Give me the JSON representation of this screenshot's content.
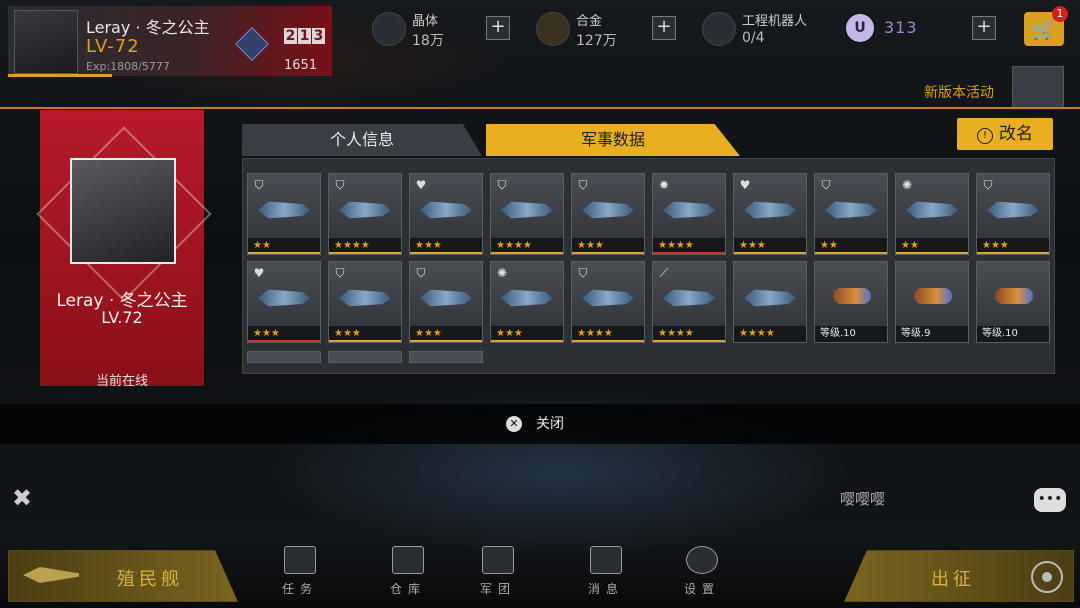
{
  "player": {
    "name": "Leray · 冬之公主",
    "level": "LV-72",
    "exp": "Exp:1808/5777",
    "rank_digits": [
      "2",
      "1",
      "3"
    ],
    "rank_score": "1651"
  },
  "resources": {
    "crystal": {
      "label": "晶体",
      "value": "18万"
    },
    "alloy": {
      "label": "合金",
      "value": "127万"
    },
    "robots": {
      "label": "工程机器人",
      "value": "0/4"
    },
    "u_currency": {
      "symbol": "U",
      "value": "313"
    }
  },
  "shop": {
    "badge": "1"
  },
  "event": {
    "label": "新版本活动"
  },
  "profile": {
    "name": "Leray · 冬之公主",
    "level": "LV.72",
    "status": "当前在线"
  },
  "tabs": [
    {
      "label": "个人信息",
      "active": false
    },
    {
      "label": "军事数据",
      "active": true
    }
  ],
  "rename_label": "改名",
  "cards_row1": [
    {
      "badge": "shield",
      "stars": "★★",
      "bar": "#e0a020"
    },
    {
      "badge": "shield",
      "stars": "★★★★",
      "bar": "#e0a020"
    },
    {
      "badge": "heart",
      "stars": "★★★",
      "bar": "#e0a020"
    },
    {
      "badge": "shield",
      "stars": "★★★★",
      "bar": "#e0a020"
    },
    {
      "badge": "shield",
      "stars": "★★★",
      "bar": "#e0a020"
    },
    {
      "badge": "gear",
      "stars": "★★★★",
      "bar": "#d03030"
    },
    {
      "badge": "heart",
      "stars": "★★★",
      "bar": "#e0a020"
    },
    {
      "badge": "shield",
      "stars": "★★",
      "bar": "#e0a020"
    },
    {
      "badge": "target",
      "stars": "★★",
      "bar": "#e0a020"
    },
    {
      "badge": "shield",
      "stars": "★★★",
      "bar": "#e0a020"
    }
  ],
  "cards_row2": [
    {
      "badge": "heart",
      "stars": "★★★",
      "bar": "#d03030"
    },
    {
      "badge": "shield",
      "stars": "★★★",
      "bar": "#e0a020"
    },
    {
      "badge": "shield",
      "stars": "★★★",
      "bar": "#e0a020"
    },
    {
      "badge": "target",
      "stars": "★★★",
      "bar": "#e0a020"
    },
    {
      "badge": "shield",
      "stars": "★★★★",
      "bar": "#e0a020"
    },
    {
      "badge": "claw",
      "stars": "★★★★",
      "bar": "#e0a020"
    },
    {
      "badge": "",
      "stars": "★★★★",
      "bar": ""
    },
    {
      "badge": "",
      "stars": "等级.10",
      "bar": "",
      "text": true
    },
    {
      "badge": "",
      "stars": "等级.9",
      "bar": "",
      "text": true
    },
    {
      "badge": "",
      "stars": "等级.10",
      "bar": "",
      "text": true
    }
  ],
  "close_label": "关闭",
  "emote_text": "嘤嘤嘤",
  "bottom": {
    "colony": "殖民舰",
    "sortie": "出征",
    "nav": [
      "任务",
      "仓库",
      "军团",
      "消息",
      "设置"
    ]
  }
}
